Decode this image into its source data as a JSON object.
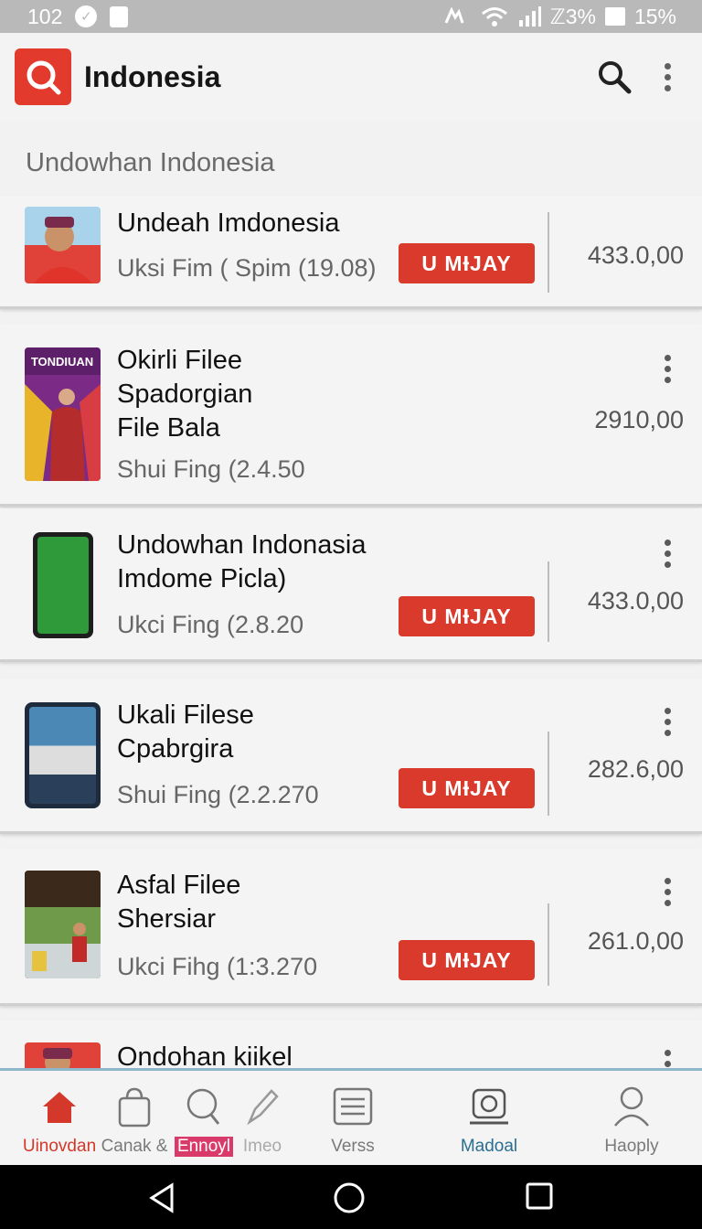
{
  "status_bar": {
    "time": "102",
    "right_text": "ℤ3%",
    "battery": "15%"
  },
  "app_bar": {
    "title": "Indonesia"
  },
  "section": {
    "title": "Undowhan Indonesia"
  },
  "items": [
    {
      "title_lines": [
        "Undeah Imdonesia"
      ],
      "subtitle": "Uksi Fim ( Spim (19.08)",
      "button": "U MƗJAY",
      "price": "433.0,00",
      "has_button": true,
      "has_more": false
    },
    {
      "title_lines": [
        "Okirli Filee",
        "Spadorgian",
        "File Bala"
      ],
      "subtitle": "Shui Fing (2.4.50",
      "button": "",
      "price": "2910,00",
      "has_button": false,
      "has_more": true,
      "thumb_text": "TONDIUAN"
    },
    {
      "title_lines": [
        "Undowhan Indonasia",
        "Imdome Picla)"
      ],
      "subtitle": "Ukci Fing (2.8.20",
      "button": "U MƗJAY",
      "price": "433.0,00",
      "has_button": true,
      "has_more": true
    },
    {
      "title_lines": [
        "Ukali Filese",
        "Cpabrgira"
      ],
      "subtitle": "Shui Fing (2.2.270",
      "button": "U MƗJAY",
      "price": "282.6,00",
      "has_button": true,
      "has_more": true
    },
    {
      "title_lines": [
        "Asfal Filee",
        "Shersiar"
      ],
      "subtitle": "Ukci Fihg (1:3.270",
      "button": "U MƗJAY",
      "price": "261.0,00",
      "has_button": true,
      "has_more": true
    },
    {
      "title_lines": [
        "Ondohan kiikel"
      ],
      "subtitle": "",
      "button": "",
      "price": "",
      "has_button": false,
      "has_more": true
    }
  ],
  "bottom_nav": [
    {
      "label": "Uinovdan",
      "icon": "home-icon",
      "state": "active"
    },
    {
      "label": "Canak &",
      "icon": "shopping-bag-icon",
      "state": "normal"
    },
    {
      "label": "Ennoyl",
      "icon": "search-icon",
      "state": "badge"
    },
    {
      "label": "Imeo",
      "icon": "edit-icon",
      "state": "faded"
    },
    {
      "label": "Verss",
      "icon": "list-icon",
      "state": "normal"
    },
    {
      "label": "Madoal",
      "icon": "device-icon",
      "state": "blue"
    },
    {
      "label": "Haoply",
      "icon": "profile-icon",
      "state": "normal"
    }
  ],
  "colors": {
    "accent": "#d93a2b",
    "nav_divider": "#8fb7cc",
    "active_nav": "#d3382b"
  }
}
